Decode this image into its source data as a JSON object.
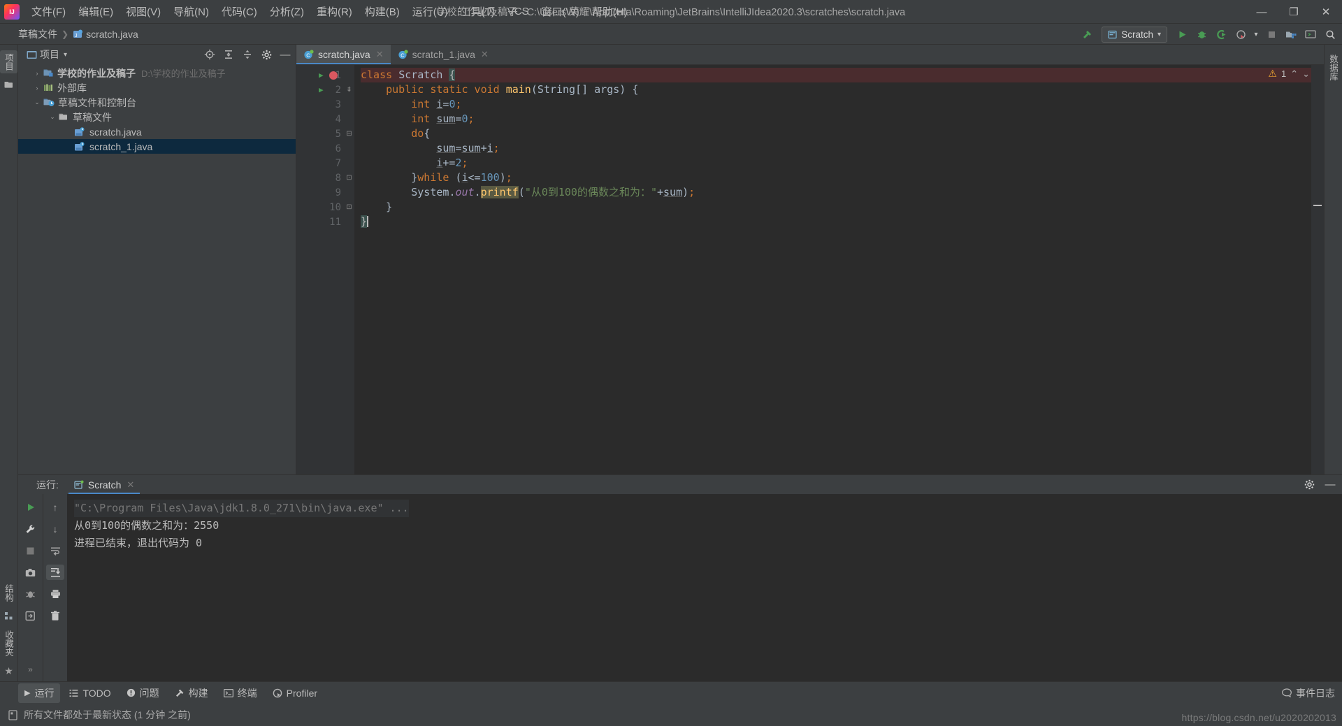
{
  "window": {
    "title": "学校的作业及稿子 - C:\\Users\\荣耀\\AppData\\Roaming\\JetBrains\\IntelliJIdea2020.3\\scratches\\scratch.java",
    "minimize_label": "—",
    "maximize_label": "❐",
    "close_label": "✕"
  },
  "menu": {
    "items": [
      {
        "label": "文件(F)"
      },
      {
        "label": "编辑(E)"
      },
      {
        "label": "视图(V)"
      },
      {
        "label": "导航(N)"
      },
      {
        "label": "代码(C)"
      },
      {
        "label": "分析(Z)"
      },
      {
        "label": "重构(R)"
      },
      {
        "label": "构建(B)"
      },
      {
        "label": "运行(U)"
      },
      {
        "label": "工具(T)"
      },
      {
        "label": "VCS"
      },
      {
        "label": "窗口(W)"
      },
      {
        "label": "帮助(H)"
      }
    ]
  },
  "breadcrumb": {
    "root": "草稿文件",
    "separator": "❯",
    "file": "scratch.java"
  },
  "run_config": {
    "name": "Scratch",
    "dropdown_glyph": "▾"
  },
  "toolbar_right": {
    "build_icon": "hammer-icon",
    "run_icon": "▶",
    "debug_icon": "debug-icon",
    "coverage_icon": "coverage-icon",
    "profile_icon": "profile-icon",
    "stop_icon": "■",
    "project_structure_icon": "project-structure-icon",
    "terminal_icon": "terminal-icon",
    "search_icon": "🔍"
  },
  "project_panel": {
    "title": "项目",
    "dropdown_glyph": "▾",
    "actions": [
      {
        "name": "locate-icon",
        "glyph": "⊕"
      },
      {
        "name": "expand-all-icon",
        "glyph": "⤓"
      },
      {
        "name": "collapse-all-icon",
        "glyph": "⤒"
      },
      {
        "name": "settings-gear-icon",
        "glyph": "⚙"
      },
      {
        "name": "hide-panel-icon",
        "glyph": "—"
      }
    ],
    "tree": [
      {
        "label": "学校的作业及稿子",
        "path": "D:\\学校的作业及稿子",
        "arrow": "›",
        "indent": 0,
        "icon": "module-icon",
        "bold": true,
        "selected": false
      },
      {
        "label": "外部库",
        "path": "",
        "arrow": "›",
        "indent": 0,
        "icon": "library-icon",
        "bold": false,
        "selected": false
      },
      {
        "label": "草稿文件和控制台",
        "path": "",
        "arrow": "⌄",
        "indent": 0,
        "icon": "scratches-icon",
        "bold": false,
        "selected": false
      },
      {
        "label": "草稿文件",
        "path": "",
        "arrow": "⌄",
        "indent": 1,
        "icon": "folder-icon",
        "bold": false,
        "selected": false
      },
      {
        "label": "scratch.java",
        "path": "",
        "arrow": "",
        "indent": 2,
        "icon": "java-scratch-icon",
        "bold": false,
        "selected": false
      },
      {
        "label": "scratch_1.java",
        "path": "",
        "arrow": "",
        "indent": 2,
        "icon": "java-scratch-icon",
        "bold": false,
        "selected": true
      }
    ]
  },
  "editor": {
    "tabs": [
      {
        "label": "scratch.java",
        "active": true,
        "close_glyph": "✕"
      },
      {
        "label": "scratch_1.java",
        "active": false,
        "close_glyph": "✕"
      }
    ],
    "inspection": {
      "warning_glyph": "⚠",
      "warning_count": "1",
      "prev_glyph": "⌃",
      "next_glyph": "⌄"
    },
    "lines": [
      {
        "n": "1",
        "run_marker": true,
        "breakpoint": true,
        "fold": "",
        "error": true
      },
      {
        "n": "2",
        "run_marker": true,
        "breakpoint": false,
        "fold": "⇟",
        "error": false
      },
      {
        "n": "3",
        "run_marker": false,
        "breakpoint": false,
        "fold": "",
        "error": false
      },
      {
        "n": "4",
        "run_marker": false,
        "breakpoint": false,
        "fold": "",
        "error": false
      },
      {
        "n": "5",
        "run_marker": false,
        "breakpoint": false,
        "fold": "⊟",
        "error": false
      },
      {
        "n": "6",
        "run_marker": false,
        "breakpoint": false,
        "fold": "",
        "error": false
      },
      {
        "n": "7",
        "run_marker": false,
        "breakpoint": false,
        "fold": "",
        "error": false
      },
      {
        "n": "8",
        "run_marker": false,
        "breakpoint": false,
        "fold": "⊡",
        "error": false
      },
      {
        "n": "9",
        "run_marker": false,
        "breakpoint": false,
        "fold": "",
        "error": false
      },
      {
        "n": "10",
        "run_marker": false,
        "breakpoint": false,
        "fold": "⊡",
        "error": false
      },
      {
        "n": "11",
        "run_marker": false,
        "breakpoint": false,
        "fold": "",
        "error": false
      }
    ],
    "code_text": [
      "class Scratch {",
      "    public static void main(String[] args) {",
      "        int i=0;",
      "        int sum=0;",
      "        do{",
      "            sum=sum+i;",
      "            i+=2;",
      "        }while (i<=100);",
      "        System.out.printf(\"从0到100的偶数之和为：\"+sum);",
      "    }",
      "}"
    ]
  },
  "console": {
    "title": "运行:",
    "tab_label": "Scratch",
    "tab_close_glyph": "✕",
    "settings_glyph": "⚙",
    "hide_glyph": "—",
    "left_tools": [
      {
        "name": "rerun-icon",
        "glyph": "▶"
      },
      {
        "name": "edit-configuration-icon",
        "glyph": "🔧"
      },
      {
        "name": "stop-icon",
        "glyph": "■"
      },
      {
        "name": "screenshot-icon",
        "glyph": "⌾"
      },
      {
        "name": "dump-threads-icon",
        "glyph": "✻"
      },
      {
        "name": "export-icon",
        "glyph": "⎘"
      }
    ],
    "right_tools": [
      {
        "name": "scroll-up-icon",
        "glyph": "↑",
        "on": false
      },
      {
        "name": "scroll-down-icon",
        "glyph": "↓",
        "on": false
      },
      {
        "name": "soft-wrap-icon",
        "glyph": "⇥",
        "on": false
      },
      {
        "name": "scroll-to-end-icon",
        "glyph": "⇟",
        "on": true
      },
      {
        "name": "print-icon",
        "glyph": "⎙",
        "on": false
      },
      {
        "name": "clear-all-icon",
        "glyph": "🗑",
        "on": false
      }
    ],
    "output": [
      {
        "text": "\"C:\\Program Files\\Java\\jdk1.8.0_271\\bin\\java.exe\" ...",
        "style": "cmd"
      },
      {
        "text": "从0到100的偶数之和为：2550",
        "style": "out"
      },
      {
        "text": "进程已结束，退出代码为 0",
        "style": "out"
      }
    ]
  },
  "rail_left": {
    "top": [
      {
        "label": "项目",
        "icon": "project-icon",
        "active": true
      }
    ],
    "bottom": [
      {
        "label": "结构",
        "icon": "structure-icon",
        "active": false
      },
      {
        "label": "收藏夹",
        "icon": "favorites-star-icon",
        "active": false
      }
    ]
  },
  "rail_right": {
    "items": [
      {
        "label": "数据库",
        "icon": "database-icon"
      }
    ]
  },
  "tool_window_bar": {
    "buttons": [
      {
        "label": "运行",
        "icon": "run-icon",
        "active": true
      },
      {
        "label": "TODO",
        "icon": "todo-icon",
        "active": false
      },
      {
        "label": "问题",
        "icon": "problems-icon",
        "active": false
      },
      {
        "label": "构建",
        "icon": "build-hammer-icon",
        "active": false
      },
      {
        "label": "终端",
        "icon": "terminal-icon",
        "active": false
      },
      {
        "label": "Profiler",
        "icon": "profiler-icon",
        "active": false
      }
    ],
    "event_log": {
      "label": "事件日志",
      "icon": "event-log-icon"
    }
  },
  "status_bar": {
    "icon": "file-status-icon",
    "message": "所有文件都处于最新状态 (1 分钟 之前)",
    "watermark": "https://blog.csdn.net/u2020202013"
  }
}
